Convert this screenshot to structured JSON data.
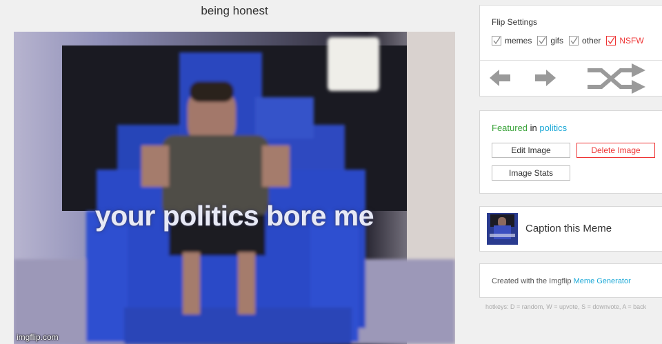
{
  "meme": {
    "title": "being honest",
    "caption": "your politics bore me",
    "watermark": "imgflip.com"
  },
  "flip_settings": {
    "title": "Flip Settings",
    "options": [
      {
        "label": "memes",
        "checked": true
      },
      {
        "label": "gifs",
        "checked": true
      },
      {
        "label": "other",
        "checked": true
      },
      {
        "label": "NSFW",
        "checked": true,
        "color": "#e33333"
      }
    ],
    "icons": [
      "arrow-left-icon",
      "arrow-right-icon",
      "shuffle-icon"
    ]
  },
  "featured": {
    "prefix": "Featured",
    "in": "in",
    "stream": "politics",
    "buttons": {
      "edit": "Edit Image",
      "delete": "Delete Image",
      "stats": "Image Stats"
    }
  },
  "caption_panel": {
    "label": "Caption this Meme"
  },
  "created": {
    "prefix": "Created with the Imgflip",
    "link": "Meme Generator"
  },
  "hotkeys": "hotkeys: D = random, W = upvote, S = downvote, A = back",
  "colors": {
    "green": "#3aa33a",
    "cyan": "#18a7d6",
    "red": "#e33333",
    "arrow_gray": "#9a9a9a"
  }
}
